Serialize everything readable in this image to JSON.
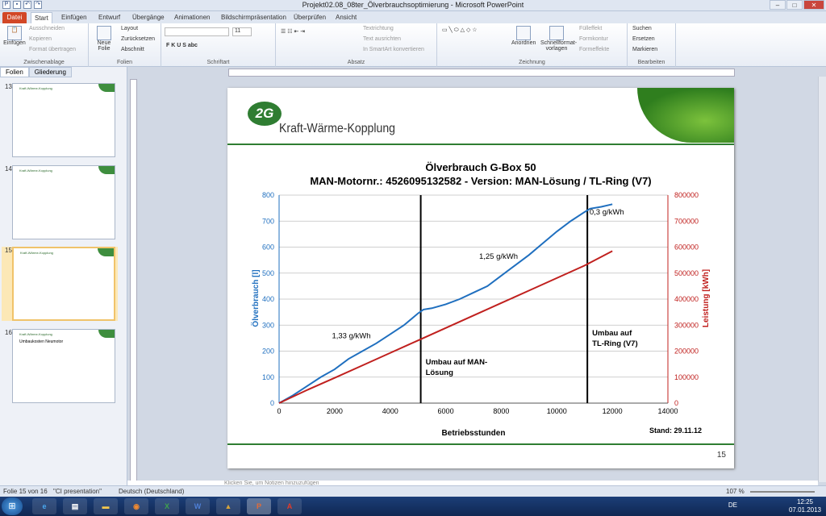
{
  "window": {
    "title": "Projekt02.08_08ter_Ölverbrauchsoptimierung - Microsoft PowerPoint"
  },
  "tabs": [
    "Datei",
    "Start",
    "Einfügen",
    "Entwurf",
    "Übergänge",
    "Animationen",
    "Bildschirmpräsentation",
    "Überprüfen",
    "Ansicht"
  ],
  "ribbon": {
    "zwischenablage": {
      "label": "Zwischenablage",
      "einfuegen": "Einfügen",
      "ausschneiden": "Ausschneiden",
      "kopieren": "Kopieren",
      "format_uebertragen": "Format übertragen"
    },
    "folien": {
      "label": "Folien",
      "neue_folie": "Neue Folie",
      "layout": "Layout",
      "zuruecksetzen": "Zurücksetzen",
      "abschnitt": "Abschnitt"
    },
    "schriftart": {
      "label": "Schriftart",
      "size": "11"
    },
    "absatz": {
      "label": "Absatz",
      "textrichtung": "Textrichtung",
      "text_ausrichten": "Text ausrichten",
      "smartart": "In SmartArt konvertieren"
    },
    "zeichnung": {
      "label": "Zeichnung",
      "anordnen": "Anordnen",
      "schnellformat": "Schnellformat-vorlagen",
      "fuelleffekt": "Fülleffekt",
      "formkontur": "Formkontur",
      "formeffekte": "Formeffekte"
    },
    "bearbeiten": {
      "label": "Bearbeiten",
      "suchen": "Suchen",
      "ersetzen": "Ersetzen",
      "markieren": "Markieren"
    }
  },
  "panel": {
    "tab_folien": "Folien",
    "tab_gliederung": "Gliederung",
    "thumbnails": [
      {
        "num": "13",
        "title": "Kraft-Wärme-Kopplung"
      },
      {
        "num": "14",
        "title": "Kraft-Wärme-Kopplung"
      },
      {
        "num": "15",
        "title": "Kraft-Wärme-Kopplung"
      },
      {
        "num": "16",
        "title": "Kraft-Wärme-Kopplung",
        "subtitle": "Umbaukosten Neumotor"
      }
    ]
  },
  "slide": {
    "logo": "2G",
    "subtitle": "Kraft-Wärme-Kopplung",
    "stand": "Stand: 29.11.12",
    "page_number": "15"
  },
  "chart_data": {
    "type": "line",
    "title": "Ölverbrauch G-Box 50",
    "subtitle": "MAN-Motornr.: 4526095132582 - Version: MAN-Lösung / TL-Ring (V7)",
    "xlabel": "Betriebsstunden",
    "ylabel": "Ölverbrauch [l]",
    "y2label": "Leistung [kWh]",
    "xlim": [
      0,
      14000
    ],
    "ylim": [
      0,
      800
    ],
    "y2lim": [
      0,
      800000
    ],
    "xticks": [
      0,
      2000,
      4000,
      6000,
      8000,
      10000,
      12000,
      14000
    ],
    "yticks": [
      0,
      100,
      200,
      300,
      400,
      500,
      600,
      700,
      800
    ],
    "y2ticks": [
      0,
      100000,
      200000,
      300000,
      400000,
      500000,
      600000,
      700000,
      800000
    ],
    "grid": true,
    "colors": {
      "oil": "#1f6fbf",
      "power": "#c0201e",
      "axis_left": "#1f6fbf",
      "axis_right": "#c0201e"
    },
    "series": [
      {
        "axis": "left",
        "x": [
          0,
          500,
          1000,
          1500,
          2000,
          2500,
          3000,
          3500,
          4000,
          4500,
          5000,
          5200,
          5500,
          6000,
          6500,
          7000,
          7500,
          8000,
          8500,
          9000,
          9500,
          10000,
          10500,
          11000,
          11200,
          11600,
          12000
        ],
        "values": [
          0,
          30,
          65,
          100,
          130,
          170,
          200,
          230,
          265,
          300,
          345,
          360,
          365,
          380,
          400,
          425,
          450,
          490,
          530,
          570,
          615,
          660,
          700,
          735,
          748,
          755,
          765
        ]
      },
      {
        "axis": "right",
        "x": [
          0,
          1000,
          2000,
          3000,
          4000,
          5000,
          6000,
          7000,
          8000,
          9000,
          10000,
          11000,
          12000
        ],
        "values": [
          0,
          50000,
          97000,
          145000,
          193000,
          241000,
          289000,
          337000,
          385000,
          433000,
          481000,
          529000,
          585000
        ]
      }
    ],
    "vlines": [
      {
        "x": 5100,
        "label_lines": [
          "Umbau auf MAN-",
          "Lösung"
        ]
      },
      {
        "x": 11100,
        "label_lines": [
          "Umbau auf",
          "TL-Ring (V7)"
        ]
      }
    ],
    "annotations": [
      {
        "text": "1,33 g/kWh",
        "x": 2600,
        "y": 250
      },
      {
        "text": "1,25 g/kWh",
        "x": 7900,
        "y": 555
      },
      {
        "text": "0,3 g/kWh",
        "x": 11800,
        "y": 725
      }
    ]
  },
  "notes": {
    "placeholder": "Klicken Sie, um Notizen hinzuzufügen"
  },
  "status": {
    "slide_info": "Folie 15 von 16",
    "theme": "\"CI presentation\"",
    "language": "Deutsch (Deutschland)",
    "zoom": "107 %"
  },
  "taskbar": {
    "lang": "DE",
    "time": "12:25",
    "date": "07.01.2013"
  }
}
